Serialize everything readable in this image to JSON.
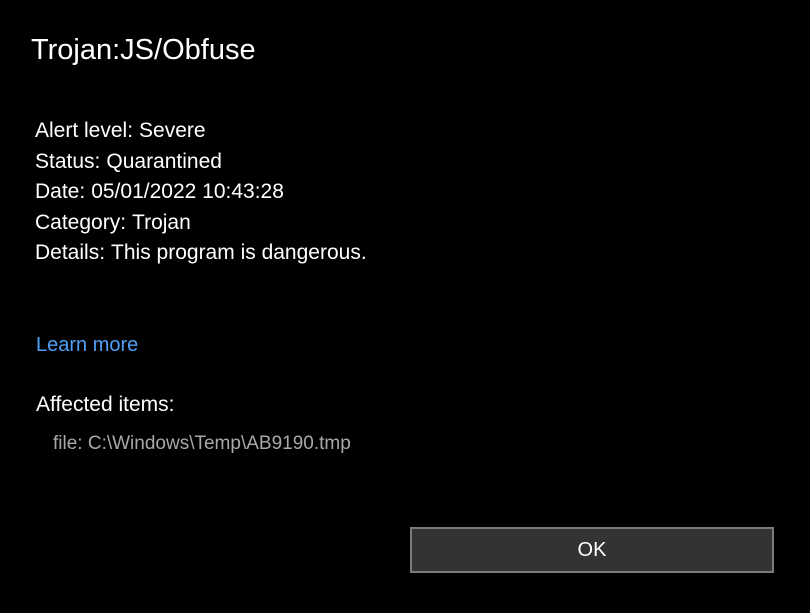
{
  "dialog": {
    "title": "Trojan:JS/Obfuse",
    "details": {
      "alert_level_label": "Alert level:",
      "alert_level_value": "Severe",
      "status_label": "Status:",
      "status_value": "Quarantined",
      "date_label": "Date:",
      "date_value": "05/01/2022 10:43:28",
      "category_label": "Category:",
      "category_value": "Trojan",
      "details_label": "Details:",
      "details_value": "This program is dangerous."
    },
    "learn_more_label": "Learn more",
    "affected_items_heading": "Affected items:",
    "affected_items": [
      "file: C:\\Windows\\Temp\\AB9190.tmp"
    ],
    "ok_button_label": "OK"
  },
  "colors": {
    "background": "#000000",
    "text": "#ffffff",
    "link": "#4fa0f5",
    "muted_text": "#a8a8a8",
    "button_background": "#333333",
    "button_border": "#7a7a7a"
  }
}
